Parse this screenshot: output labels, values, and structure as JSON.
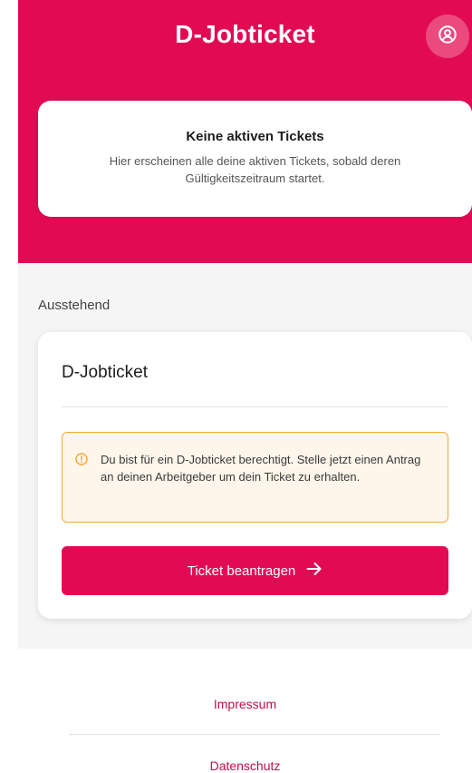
{
  "header": {
    "title": "D-Jobticket",
    "profile_icon": "account-circle-icon"
  },
  "active_tickets": {
    "title": "Keine aktiven Tickets",
    "description": "Hier erscheinen alle deine aktiven Tickets, sobald deren Gültigkeitszeitraum startet."
  },
  "pending": {
    "section_label": "Ausstehend",
    "card_title": "D-Jobticket",
    "notice_icon": "info-circle-icon",
    "notice_text": "Du bist für ein D-Jobticket berechtigt. Stelle jetzt einen Antrag an deinen Arbeitgeber um dein Ticket zu erhalten.",
    "button_label": "Ticket beantragen",
    "button_icon": "arrow-right-icon"
  },
  "footer": {
    "links": [
      "Impressum",
      "Datenschutz"
    ]
  },
  "colors": {
    "brand": "#e20b53",
    "warning_border": "#f3a83b",
    "warning_background": "#fff6eb"
  }
}
